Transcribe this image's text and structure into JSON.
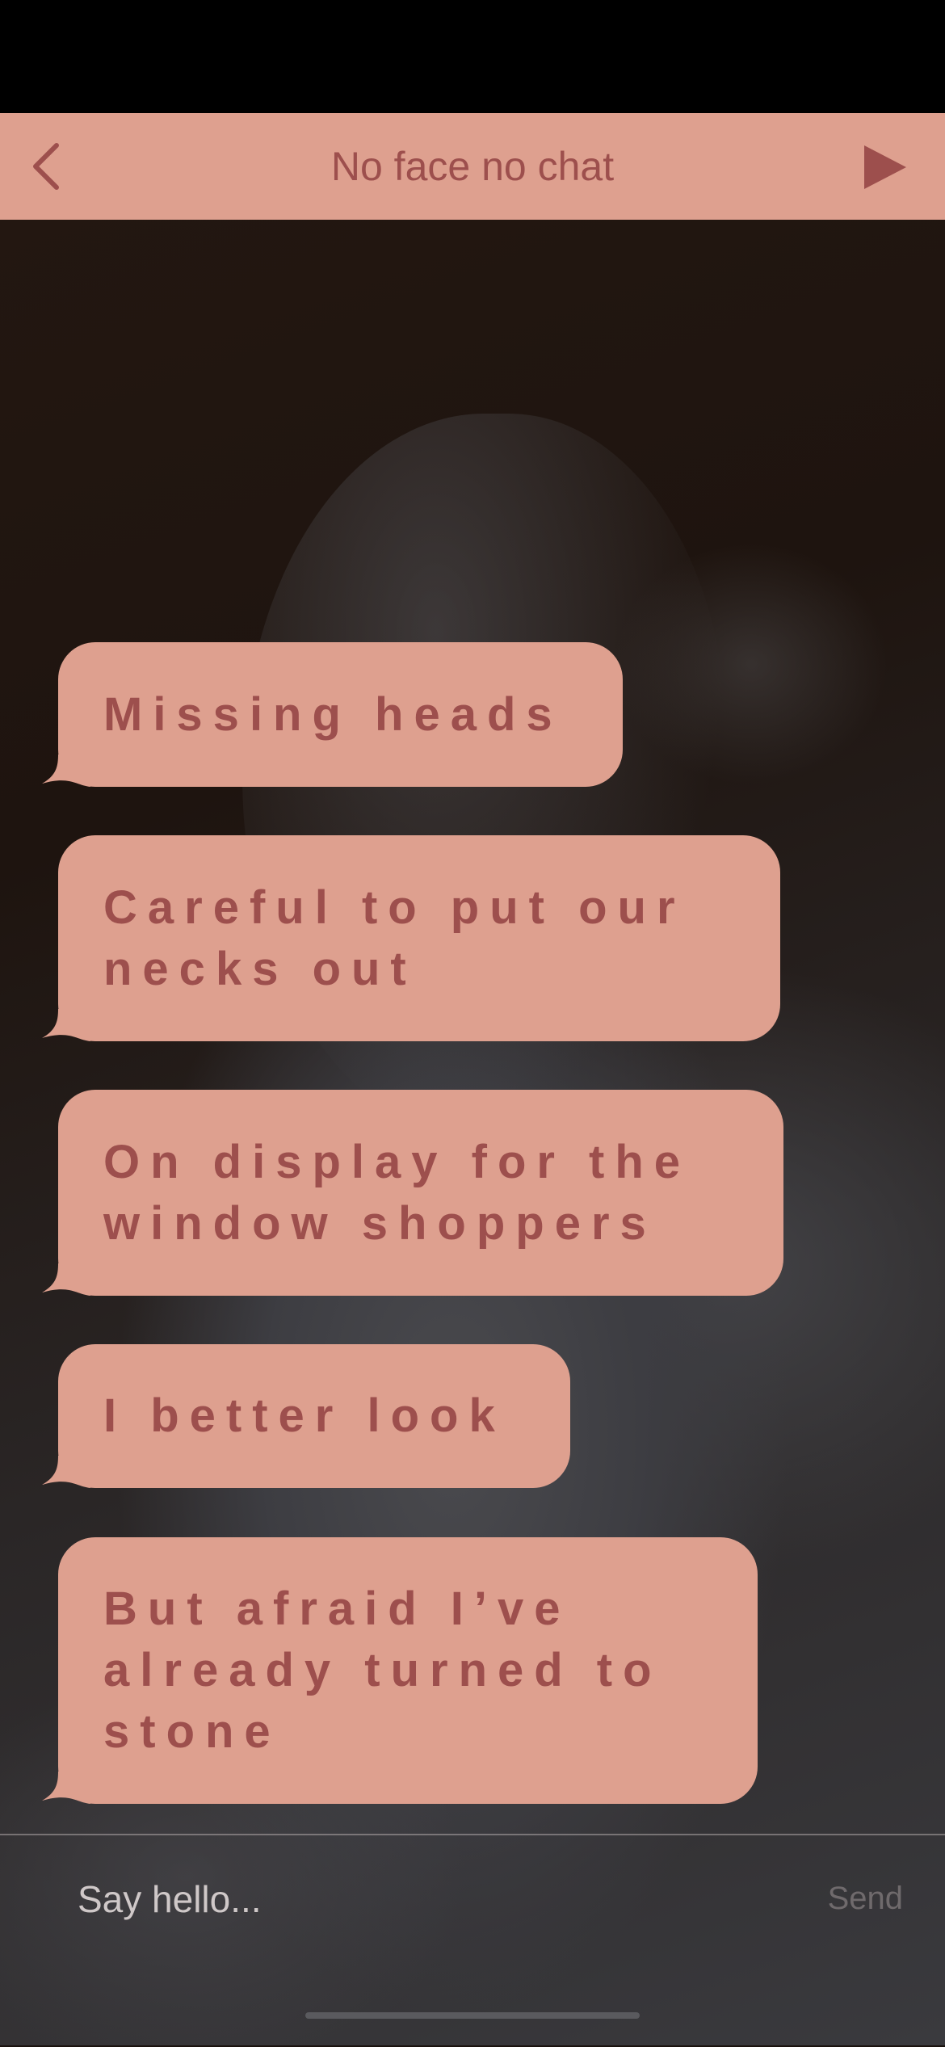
{
  "header": {
    "title": "No face no chat",
    "back_icon": "chevron-left-icon",
    "play_icon": "play-icon"
  },
  "messages": [
    {
      "text": "Missing heads"
    },
    {
      "text": "Careful to put our necks out"
    },
    {
      "text": "On display for the window shoppers"
    },
    {
      "text": "I better look"
    },
    {
      "text": "But afraid I’ve already turned to stone"
    }
  ],
  "composer": {
    "placeholder": "Say hello...",
    "send_label": "Send"
  },
  "colors": {
    "accent": "#dea08f",
    "accent_text": "#9d4f4d",
    "status_bar": "#000000"
  }
}
